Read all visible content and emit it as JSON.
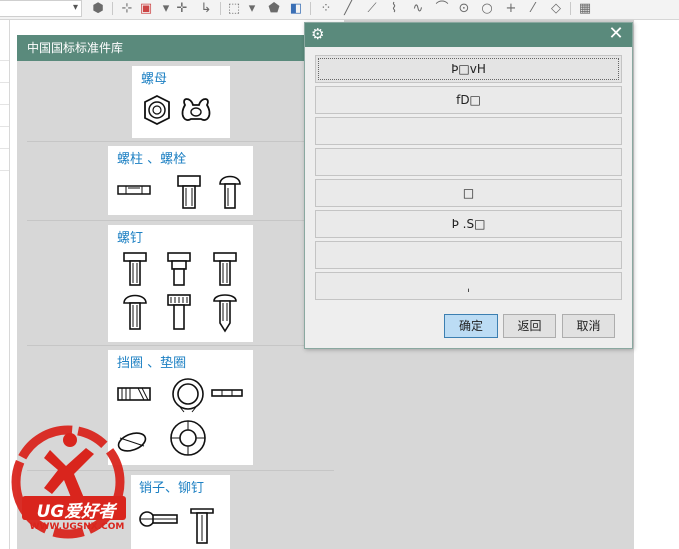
{
  "toolbar": {
    "icons": [
      "dropdown",
      "cube-icon",
      "snap-icon",
      "select-icon",
      "point-icon",
      "route-icon",
      "box-select-icon",
      "solid-icon",
      "view-icon",
      "line-icon",
      "arc-icon",
      "spline-icon",
      "circle-icon",
      "circle-icon",
      "plus-icon",
      "slash-icon",
      "diamond-icon",
      "table-icon"
    ]
  },
  "library": {
    "title": "中国国标标准件库",
    "categories": [
      {
        "name": "螺母"
      },
      {
        "name": "螺柱 、螺栓"
      },
      {
        "name": "螺钉"
      },
      {
        "name": "挡圈 、垫圈"
      },
      {
        "name": "销子、铆钉"
      }
    ]
  },
  "dialog": {
    "options": [
      "Ϸ□vH",
      "fD□",
      "",
      "",
      "□",
      "Ϸ .S□",
      "",
      "ˌ"
    ],
    "buttons": {
      "ok": "确定",
      "back": "返回",
      "cancel": "取消"
    }
  },
  "watermark": {
    "brand": "UG爱好者",
    "url": "WWW.UGSNX.COM"
  }
}
